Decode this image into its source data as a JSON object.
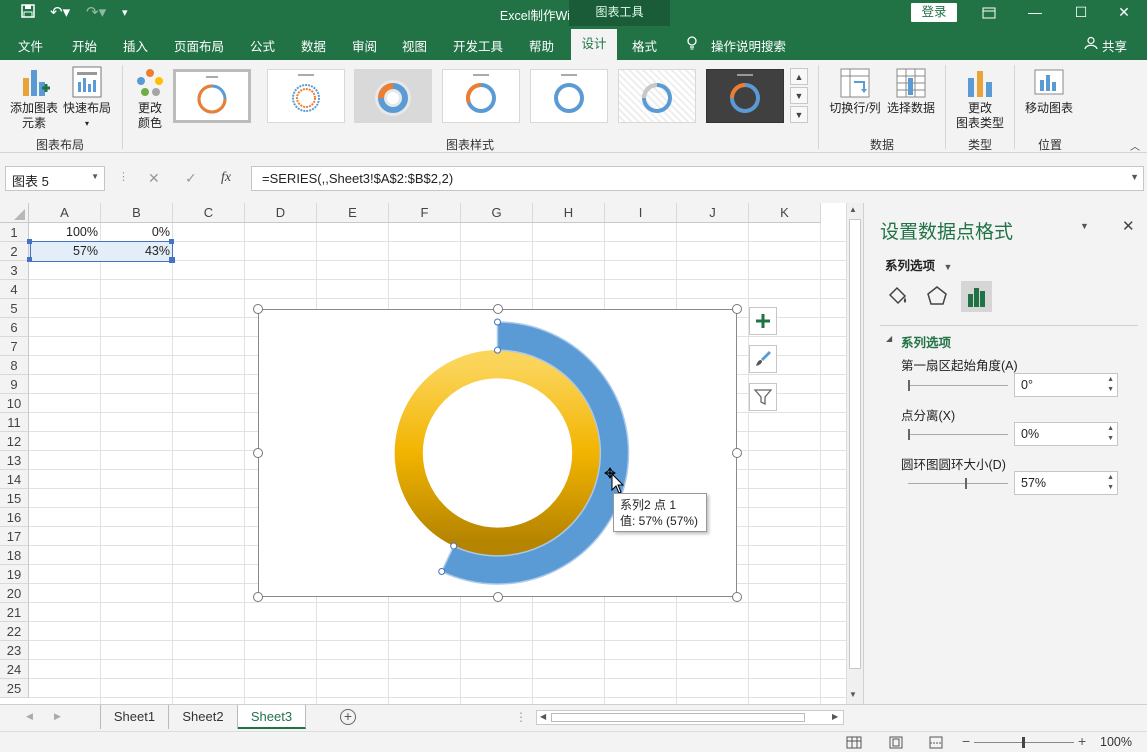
{
  "titlebar": {
    "doc_title": "Excel制作WiFi.xlsx  -  Excel",
    "context_tab": "图表工具",
    "login": "登录"
  },
  "menu": {
    "items": [
      "文件",
      "开始",
      "插入",
      "页面布局",
      "公式",
      "数据",
      "审阅",
      "视图",
      "开发工具",
      "帮助",
      "设计",
      "格式"
    ],
    "search": "操作说明搜索",
    "share": "共享"
  },
  "ribbon": {
    "add_element": [
      "添加图表",
      "元素"
    ],
    "quick_layout": "快速布局",
    "change_color": [
      "更改",
      "颜色"
    ],
    "switch_rowcol": "切换行/列",
    "select_data": "选择数据",
    "change_type": [
      "更改",
      "图表类型"
    ],
    "move_chart": "移动图表",
    "groups": {
      "layout": "图表布局",
      "styles": "图表样式",
      "data": "数据",
      "type": "类型",
      "location": "位置"
    }
  },
  "formula_bar": {
    "name_box": "图表 5",
    "fx": "fx",
    "formula": "=SERIES(,,Sheet3!$A$2:$B$2,2)"
  },
  "grid": {
    "columns": [
      "A",
      "B",
      "C",
      "D",
      "E",
      "F",
      "G",
      "H",
      "I",
      "J",
      "K"
    ],
    "rows": [
      "1",
      "2",
      "3",
      "4",
      "5",
      "6",
      "7",
      "8",
      "9",
      "10",
      "11",
      "12",
      "13",
      "14",
      "15",
      "16",
      "17",
      "18",
      "19",
      "20",
      "21",
      "22",
      "23",
      "24",
      "25"
    ],
    "cells": {
      "A1": "100%",
      "B1": "0%",
      "A2": "57%",
      "B2": "43%"
    }
  },
  "chart_data": {
    "type": "pie",
    "subtype": "doughnut",
    "series": [
      {
        "values": [
          1.0,
          0.0
        ],
        "color": "#f2b21a"
      },
      {
        "values": [
          0.57,
          0.43
        ],
        "color": "#5b9bd5"
      }
    ],
    "selected_point_series_index": 1,
    "hole_size_percent": 57,
    "tooltip": [
      "系列2 点 1",
      "值: 57% (57%)"
    ]
  },
  "task_pane": {
    "title": "设置数据点格式",
    "section": "系列选项",
    "subsection": "系列选项",
    "fields": [
      {
        "label": "第一扇区起始角度(A)",
        "value": "0°",
        "slider": 0
      },
      {
        "label": "点分离(X)",
        "value": "0%",
        "slider": 0
      },
      {
        "label": "圆环图圆环大小(D)",
        "value": "57%",
        "slider": 0.57
      }
    ]
  },
  "sheets": {
    "tabs": [
      "Sheet1",
      "Sheet2",
      "Sheet3"
    ],
    "active": "Sheet3"
  },
  "status": {
    "zoom": "100%"
  },
  "colors": {
    "excel_green": "#217346",
    "donut_blue": "#5b9bd5",
    "donut_gold": "#f2b21a"
  }
}
